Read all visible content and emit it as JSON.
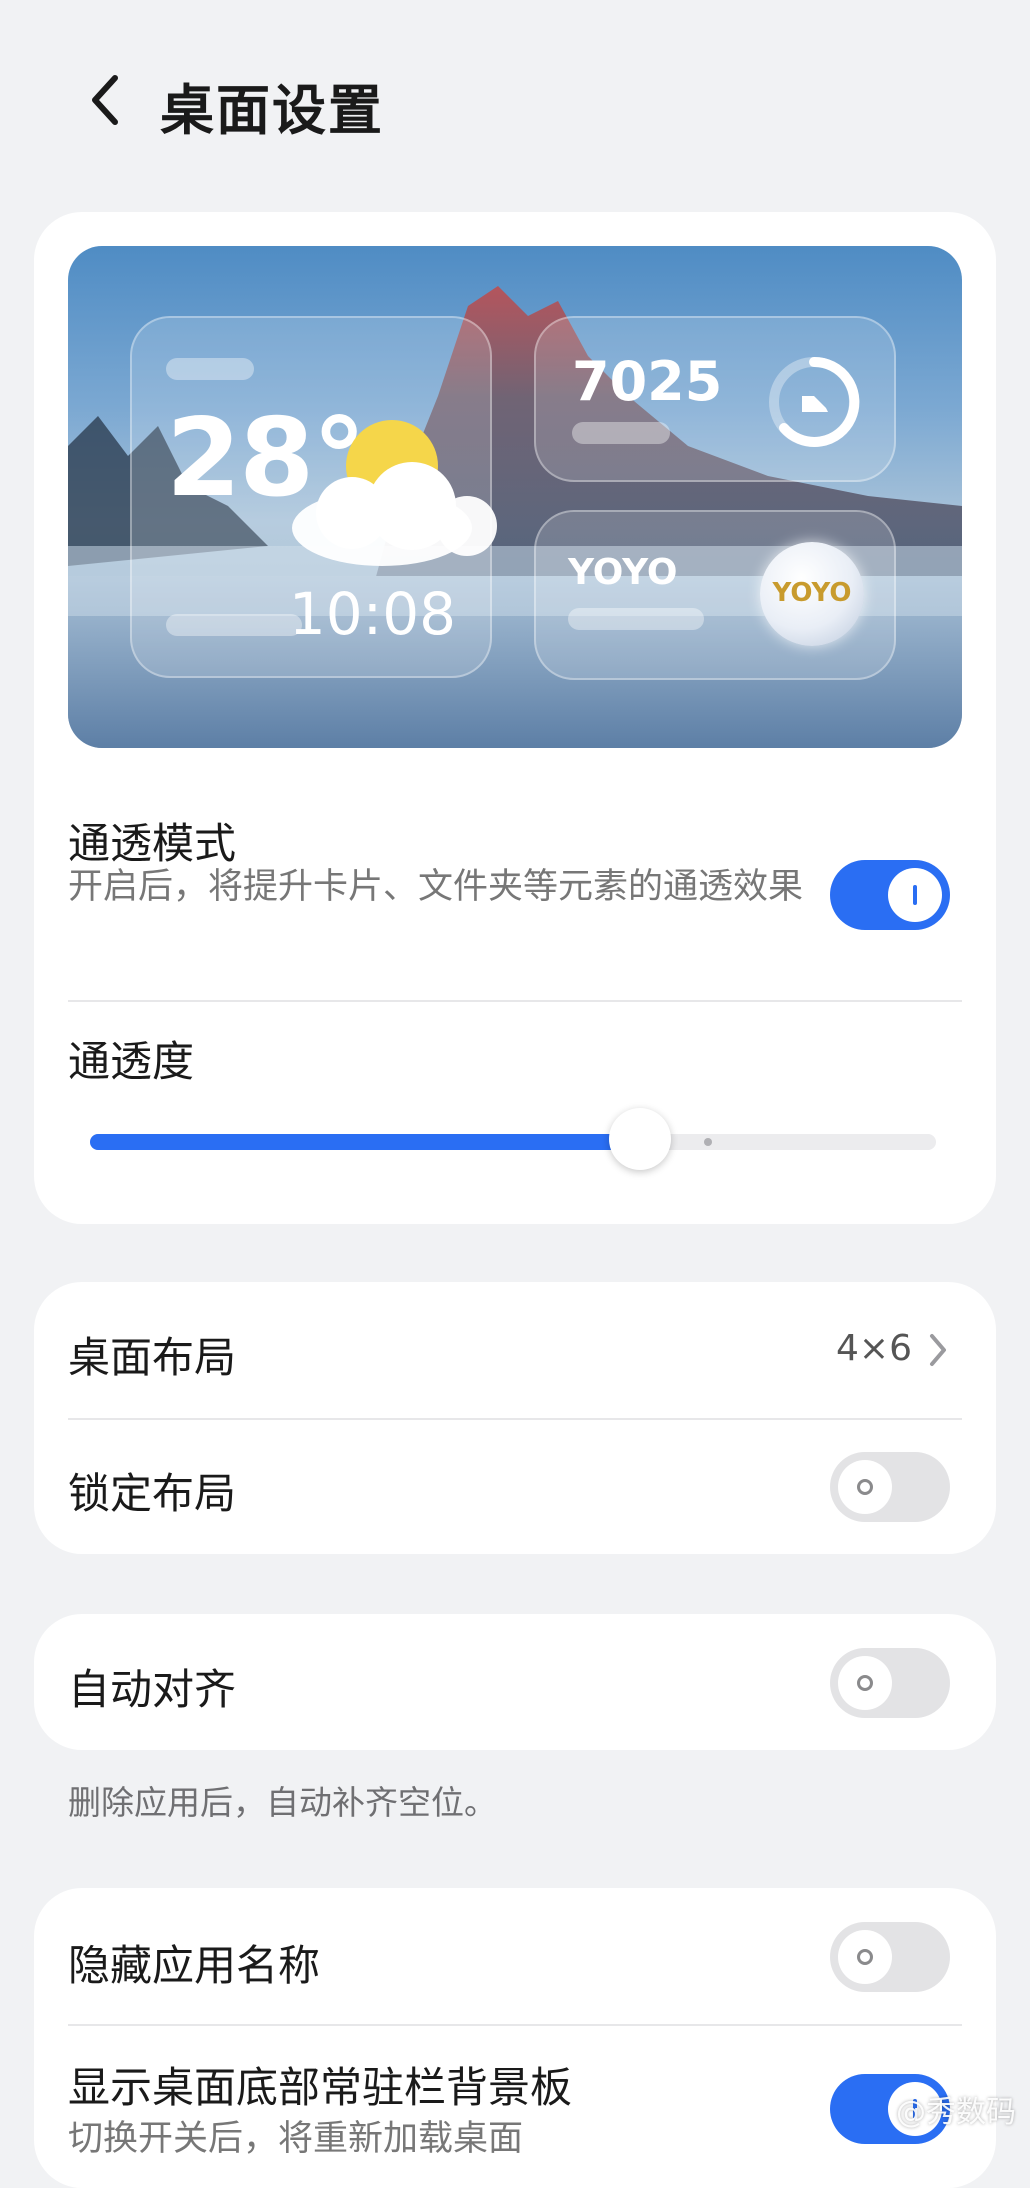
{
  "header": {
    "title": "桌面设置"
  },
  "preview": {
    "temperature": "28°",
    "time": "10:08",
    "steps": "7025",
    "yoyo_label": "YOYO",
    "yoyo_badge": "YOYO"
  },
  "transparency": {
    "title": "通透模式",
    "description": "开启后，将提升卡片、文件夹等元素的通透效果",
    "enabled": true,
    "level_label": "通透度",
    "level": 0.65
  },
  "layout": {
    "title": "桌面布局",
    "value": "4×6",
    "lock_title": "锁定布局",
    "lock_enabled": false
  },
  "align": {
    "title": "自动对齐",
    "enabled": false,
    "footnote": "删除应用后，自动补齐空位。"
  },
  "names": {
    "hide_title": "隐藏应用名称",
    "hide_enabled": false,
    "dock_title": "显示桌面底部常驻栏背景板",
    "dock_subtitle": "切换开关后，将重新加载桌面",
    "dock_enabled": true
  },
  "watermark": "@秀数码",
  "colors": {
    "accent": "#2a6ef3",
    "background": "#f1f2f4",
    "card": "#ffffff"
  }
}
